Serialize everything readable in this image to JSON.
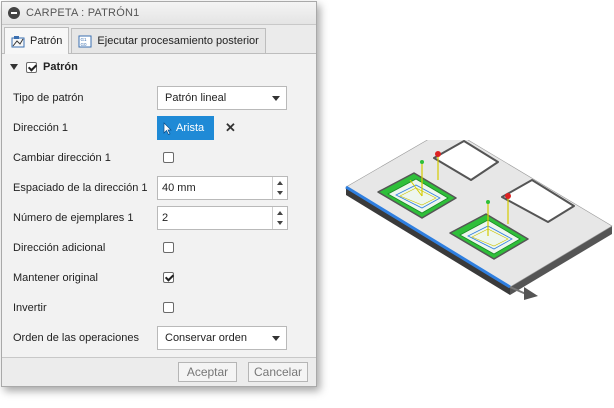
{
  "dialog": {
    "title": "CARPETA : PATRÓN1",
    "tabs": [
      {
        "label": "Patrón",
        "icon": "pattern-icon",
        "active": true
      },
      {
        "label": "Ejecutar procesamiento posterior",
        "icon": "post-process-icon",
        "active": false
      }
    ],
    "section": {
      "label": "Patrón",
      "checked": true
    }
  },
  "fields": {
    "tipo": {
      "label": "Tipo de patrón",
      "value": "Patrón lineal"
    },
    "direccion1": {
      "label": "Dirección 1",
      "value": "Arista"
    },
    "cambiar": {
      "label": "Cambiar dirección 1",
      "checked": false
    },
    "espaciado": {
      "label": "Espaciado de la dirección 1",
      "value": "40 mm"
    },
    "ejemplares": {
      "label": "Número de ejemplares 1",
      "value": "2"
    },
    "adicional": {
      "label": "Dirección adicional",
      "checked": false
    },
    "mantener": {
      "label": "Mantener original",
      "checked": true
    },
    "invertir": {
      "label": "Invertir",
      "checked": false
    },
    "orden": {
      "label": "Orden de las operaciones",
      "value": "Conservar orden"
    }
  },
  "footer": {
    "accept": "Aceptar",
    "cancel": "Cancelar"
  },
  "colors": {
    "accent": "#1f8ad6",
    "edge_highlight": "#2f7fe0",
    "pocket_green": "#2fbf3a"
  }
}
